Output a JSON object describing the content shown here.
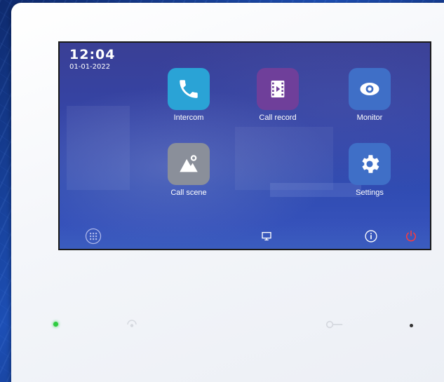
{
  "status": {
    "time": "12:04",
    "date": "01-01-2022"
  },
  "apps": [
    {
      "name": "intercom",
      "label": "Intercom",
      "icon": "phone-icon",
      "color": "#2aa3d6"
    },
    {
      "name": "call-record",
      "label": "Call record",
      "icon": "film-icon",
      "color": "#6f3f9a"
    },
    {
      "name": "monitor",
      "label": "Monitor",
      "icon": "eye-icon",
      "color": "#3f6fc7"
    },
    {
      "name": "call-scene",
      "label": "Call scene",
      "icon": "mountain-icon",
      "color": "#8a8f9a"
    },
    {
      "name": "settings",
      "label": "Settings",
      "icon": "gear-icon",
      "color": "#3f6fc7"
    }
  ],
  "bottom_bar": {
    "left_icon": "grid-dial-icon",
    "center_icon": "display-icon",
    "info_icon": "info-icon",
    "power_icon": "power-icon",
    "power_color": "#ff3b3b"
  },
  "device": {
    "left_led_color": "#2ecc40",
    "right_led_color": "#333333"
  }
}
